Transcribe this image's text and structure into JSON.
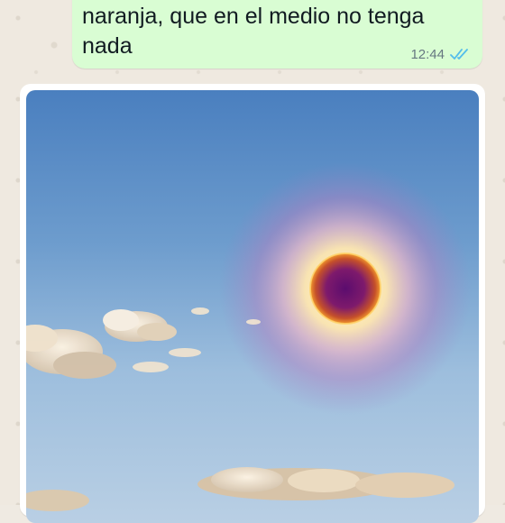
{
  "chat": {
    "outgoing_message": {
      "text": "naranja, que en el medio no tenga nada",
      "time": "12:44",
      "status_icon": "double-check-read-icon",
      "status_color": "#53bdeb"
    },
    "incoming_image": {
      "description_icon": "eclipse-sun-sky-image"
    }
  },
  "colors": {
    "outgoing_bubble": "#d9fdd3",
    "incoming_bubble": "#ffffff",
    "wallpaper": "#efe9e0",
    "time_text": "#667781",
    "message_text": "#111b21"
  }
}
